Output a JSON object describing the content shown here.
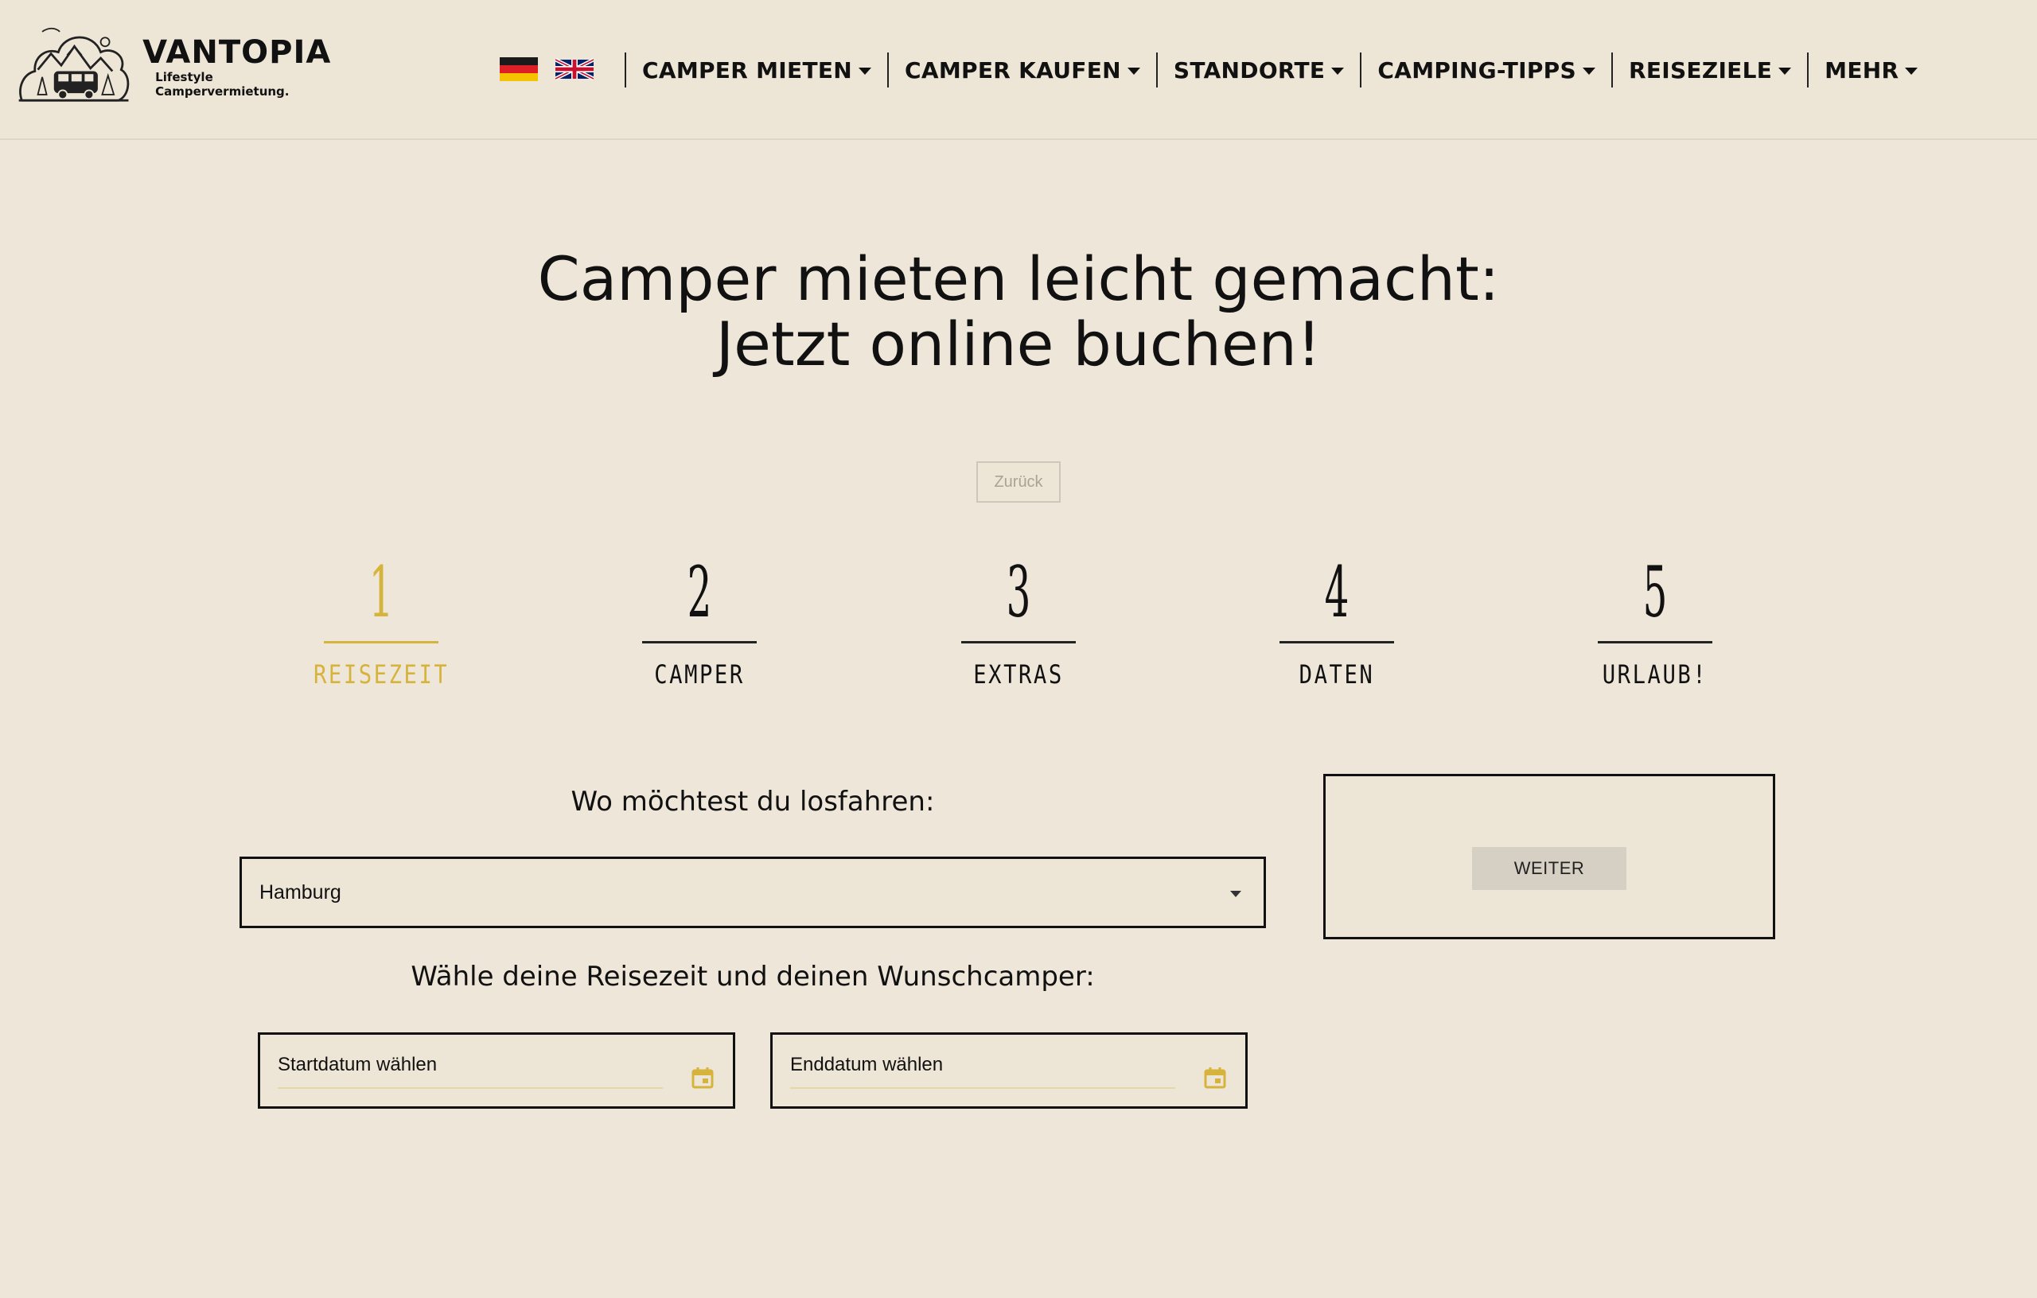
{
  "brand": {
    "name": "VANTOPIA",
    "tagline": "Lifestyle Campervermietung."
  },
  "languages": [
    {
      "icon": "german-flag-icon"
    },
    {
      "icon": "uk-flag-icon"
    }
  ],
  "nav": {
    "items": [
      {
        "label": "CAMPER MIETEN"
      },
      {
        "label": "CAMPER KAUFEN"
      },
      {
        "label": "STANDORTE"
      },
      {
        "label": "CAMPING-TIPPS"
      },
      {
        "label": "REISEZIELE"
      },
      {
        "label": "MEHR"
      }
    ]
  },
  "hero": {
    "line1": "Camper mieten leicht gemacht:",
    "line2": "Jetzt online buchen!"
  },
  "back_button": "Zurück",
  "steps": [
    {
      "num": "1",
      "label": "Reisezeit",
      "active": true
    },
    {
      "num": "2",
      "label": "Camper",
      "active": false
    },
    {
      "num": "3",
      "label": "Extras",
      "active": false
    },
    {
      "num": "4",
      "label": "Daten",
      "active": false
    },
    {
      "num": "5",
      "label": "Urlaub!",
      "active": false
    }
  ],
  "form": {
    "location_question": "Wo möchtest du losfahren:",
    "location_value": "Hamburg",
    "date_question": "Wähle deine Reisezeit und deinen Wunschcamper:",
    "start_placeholder": "Startdatum wählen",
    "end_placeholder": "Enddatum wählen"
  },
  "sidebar": {
    "next_button": "WEITER"
  },
  "colors": {
    "background": "#eee6d8",
    "accent": "#d6b33a",
    "text": "#111111"
  }
}
